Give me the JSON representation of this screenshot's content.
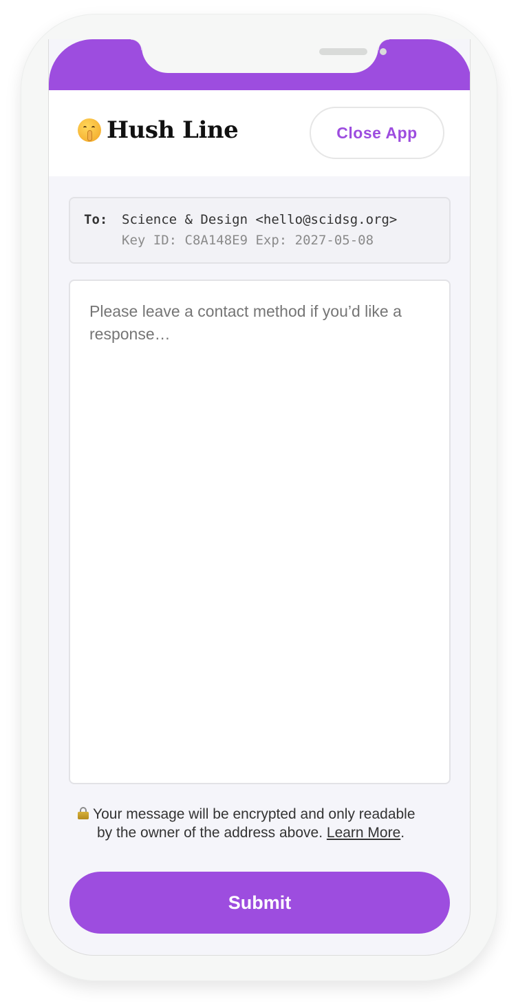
{
  "header": {
    "brand_icon": "shushing-face-icon",
    "title": "Hush Line",
    "close_button": "Close App"
  },
  "recipient": {
    "to_label": "To:",
    "name": "Science & Design <hello@scidsg.org>",
    "key_line": "Key ID: C8A148E9  Exp: 2027-05-08"
  },
  "message": {
    "placeholder": "Please leave a contact method if you’d like a response…",
    "value": ""
  },
  "notice": {
    "icon": "lock-icon",
    "line1": "Your message will be encrypted and only readable",
    "line2_prefix": "by the owner of the address above.",
    "link_label": "Learn More",
    "line2_suffix": "."
  },
  "submit_label": "Submit",
  "colors": {
    "accent": "#9d4ddf",
    "background": "#f5f5fa"
  }
}
